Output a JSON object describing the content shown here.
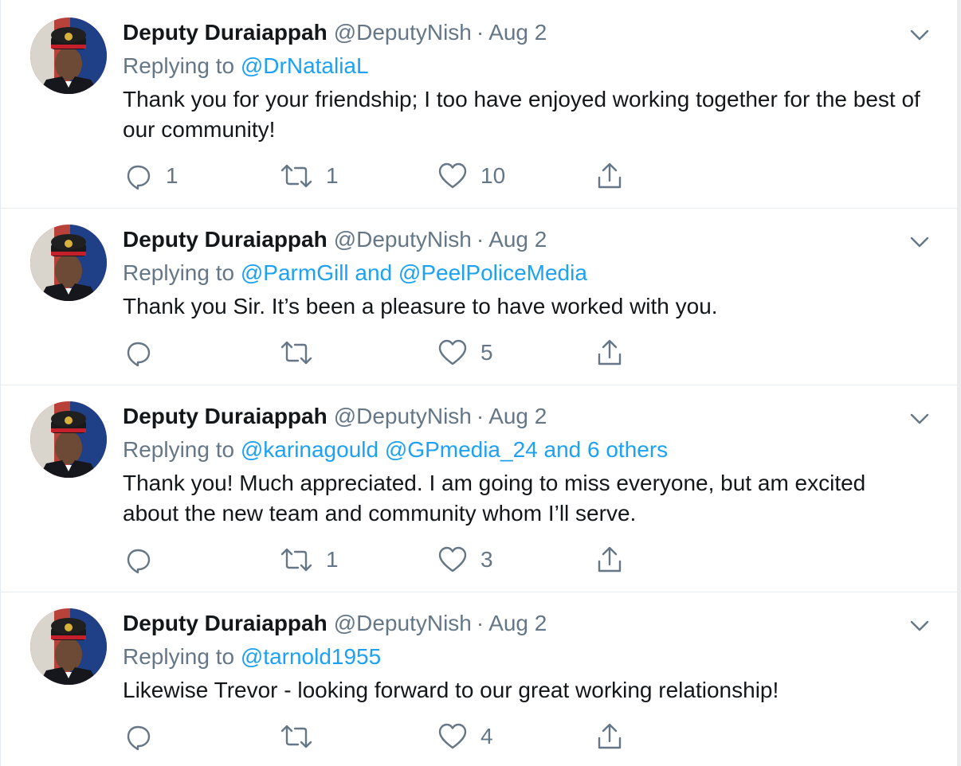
{
  "tweets": [
    {
      "author_name": "Deputy Duraiappah",
      "handle": "@DeputyNish",
      "separator": "·",
      "date": "Aug 2",
      "replying_prefix": "Replying to",
      "mentions": [
        "@DrNataliaL"
      ],
      "mentions_joiner": "",
      "mentions_suffix": "",
      "text": "Thank you for your friendship; I too have enjoyed working together for the best of our community!",
      "reply_count": "1",
      "retweet_count": "1",
      "like_count": "10"
    },
    {
      "author_name": "Deputy Duraiappah",
      "handle": "@DeputyNish",
      "separator": "·",
      "date": "Aug 2",
      "replying_prefix": "Replying to",
      "mentions": [
        "@ParmGill",
        "@PeelPoliceMedia"
      ],
      "mentions_joiner": "and",
      "mentions_suffix": "",
      "text": "Thank you Sir.  It’s been a pleasure to  have worked with you.",
      "reply_count": "",
      "retweet_count": "",
      "like_count": "5"
    },
    {
      "author_name": "Deputy Duraiappah",
      "handle": "@DeputyNish",
      "separator": "·",
      "date": "Aug 2",
      "replying_prefix": "Replying to",
      "mentions": [
        "@karinagould",
        "@GPmedia_24"
      ],
      "mentions_joiner": "",
      "mentions_suffix": "and 6 others",
      "text": "Thank you! Much appreciated. I am going to miss everyone, but am excited about the new team and community whom I’ll serve.",
      "reply_count": "",
      "retweet_count": "1",
      "like_count": "3"
    },
    {
      "author_name": "Deputy Duraiappah",
      "handle": "@DeputyNish",
      "separator": "·",
      "date": "Aug 2",
      "replying_prefix": "Replying to",
      "mentions": [
        "@tarnold1955"
      ],
      "mentions_joiner": "",
      "mentions_suffix": "",
      "text": "Likewise Trevor - looking forward to our great working relationship!",
      "reply_count": "",
      "retweet_count": "",
      "like_count": "4"
    }
  ],
  "icons": {
    "avatar": "avatar-police-officer",
    "caret": "chevron-down-icon",
    "reply": "reply-icon",
    "retweet": "retweet-icon",
    "like": "heart-icon",
    "share": "share-icon"
  },
  "colors": {
    "link": "#1da1f2",
    "secondary_text": "#657786",
    "primary_text": "#14171a",
    "divider": "#e6ecf0"
  }
}
